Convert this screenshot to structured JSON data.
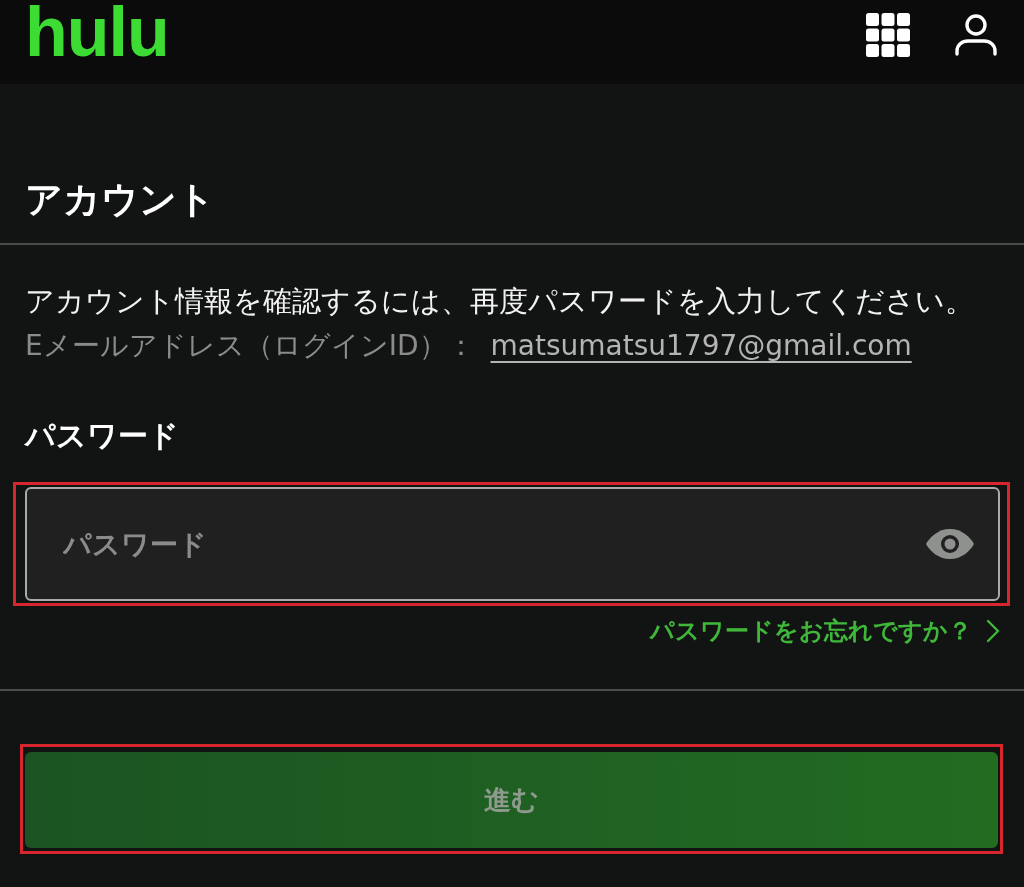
{
  "header": {
    "logo": "hulu"
  },
  "page": {
    "title": "アカウント",
    "intro": "アカウント情報を確認するには、再度パスワードを入力してください。"
  },
  "email": {
    "label": "Eメールアドレス（ログインID）：",
    "value": "matsumatsu1797@gmail.com"
  },
  "password": {
    "label": "パスワード",
    "placeholder": "パスワード",
    "highlighted": true
  },
  "forgot_link": "パスワードをお忘れですか？",
  "submit_button": {
    "label": "進む",
    "disabled": true,
    "highlighted": true
  }
}
